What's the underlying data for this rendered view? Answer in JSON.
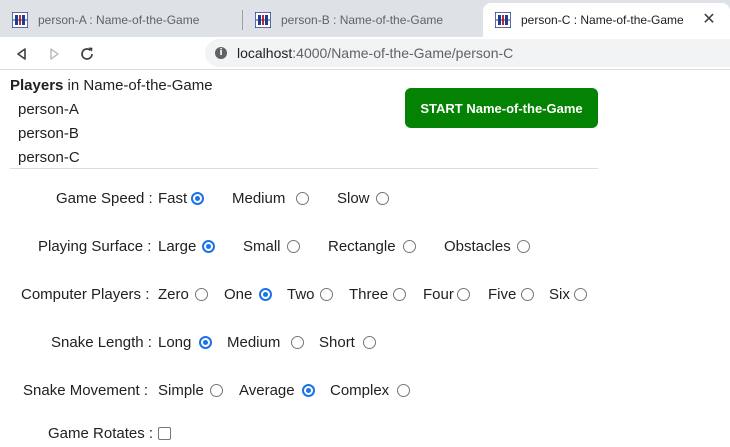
{
  "browser": {
    "tabs": [
      {
        "title": "person-A : Name-of-the-Game",
        "active": false
      },
      {
        "title": "person-B : Name-of-the-Game",
        "active": false
      },
      {
        "title": "person-C : Name-of-the-Game",
        "active": true
      }
    ],
    "close_glyph": "✕",
    "url_host": "localhost",
    "url_path": ":4000/Name-of-the-Game/person-C"
  },
  "players": {
    "heading_bold": "Players",
    "heading_rest": " in Name-of-the-Game",
    "list": [
      "person-A",
      "person-B",
      "person-C"
    ]
  },
  "start_button": "START Name-of-the-Game",
  "options": {
    "game_speed": {
      "label": "Game Speed :",
      "choices": [
        "Fast",
        "Medium",
        "Slow"
      ],
      "selected": "Fast"
    },
    "playing_surface": {
      "label": "Playing Surface :",
      "choices": [
        "Large",
        "Small",
        "Rectangle",
        "Obstacles"
      ],
      "selected": "Large"
    },
    "computer_players": {
      "label": "Computer Players :",
      "choices": [
        "Zero",
        "One",
        "Two",
        "Three",
        "Four",
        "Five",
        "Six"
      ],
      "selected": "One"
    },
    "snake_length": {
      "label": "Snake Length :",
      "choices": [
        "Long",
        "Medium",
        "Short"
      ],
      "selected": "Long"
    },
    "snake_movement": {
      "label": "Snake Movement :",
      "choices": [
        "Simple",
        "Average",
        "Complex"
      ],
      "selected": "Average"
    },
    "game_rotates": {
      "label": "Game Rotates :",
      "checked": false
    }
  },
  "colors": {
    "start_button_bg": "#038203",
    "radio_selected": "#1a73e8",
    "tabstrip_bg": "#dee1e6"
  }
}
